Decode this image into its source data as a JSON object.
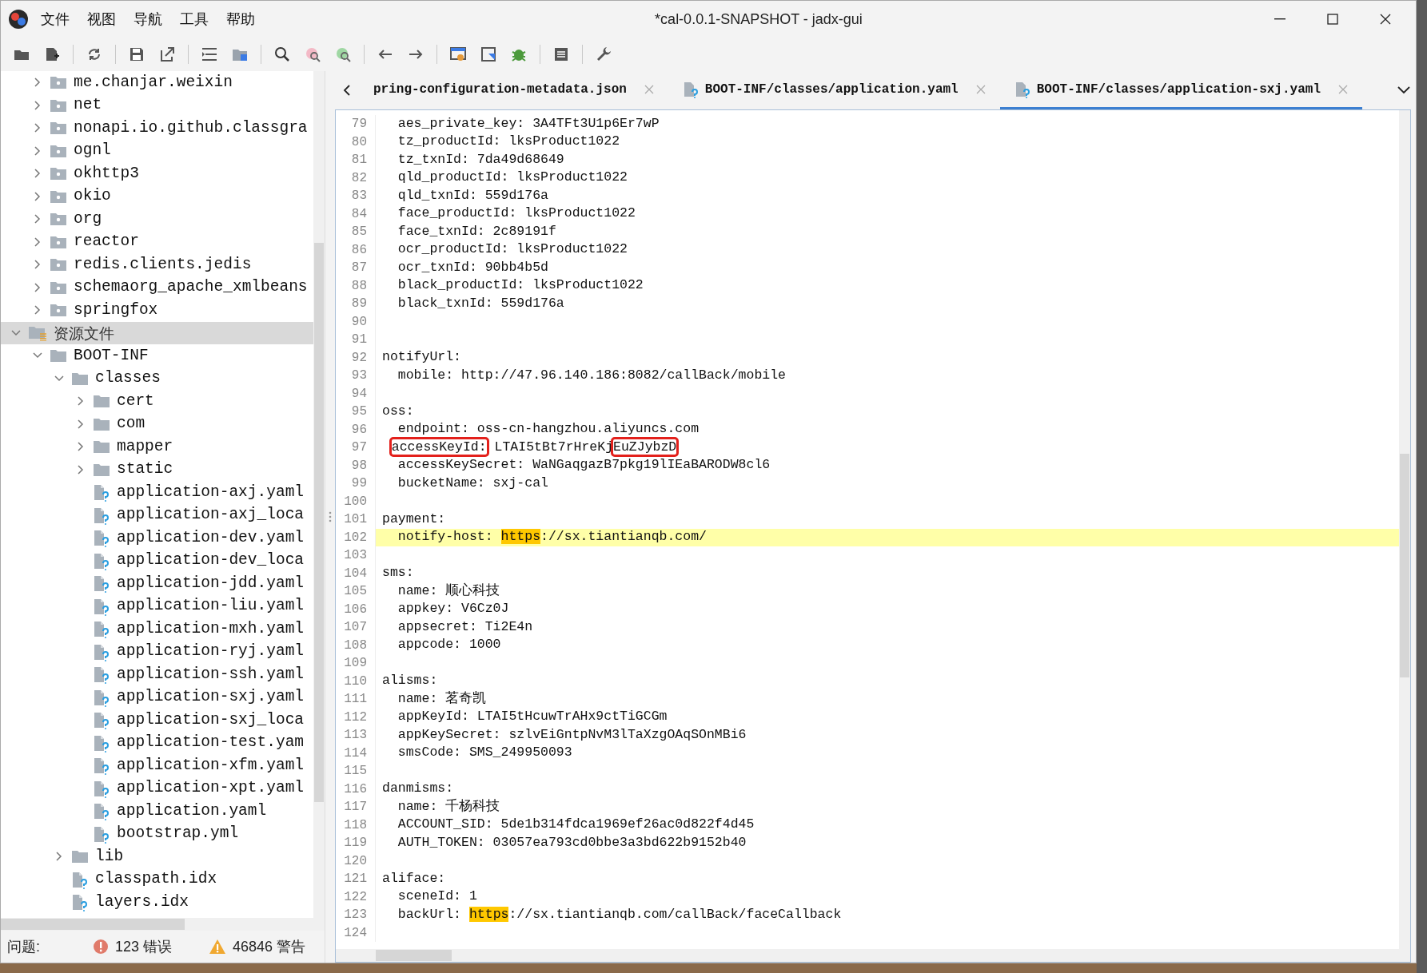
{
  "window": {
    "title": "*cal-0.0.1-SNAPSHOT - jadx-gui"
  },
  "menu": [
    "文件",
    "视图",
    "导航",
    "工具",
    "帮助"
  ],
  "tree": [
    {
      "children": [
        {
          "label": "me.chanjar.weixin",
          "kind": "package",
          "expanded": false,
          "selected": false
        },
        {
          "label": "net",
          "kind": "package",
          "expanded": false,
          "selected": false
        },
        {
          "label": "nonapi.io.github.classgra",
          "kind": "package",
          "expanded": false,
          "selected": false
        },
        {
          "label": "ognl",
          "kind": "package",
          "expanded": false,
          "selected": false
        },
        {
          "label": "okhttp3",
          "kind": "package",
          "expanded": false,
          "selected": false
        },
        {
          "label": "okio",
          "kind": "package",
          "expanded": false,
          "selected": false
        },
        {
          "label": "org",
          "kind": "package",
          "expanded": false,
          "selected": false
        },
        {
          "label": "reactor",
          "kind": "package",
          "expanded": false,
          "selected": false
        },
        {
          "label": "redis.clients.jedis",
          "kind": "package",
          "expanded": false,
          "selected": false
        },
        {
          "label": "schemaorg_apache_xmlbeans",
          "kind": "package",
          "expanded": false,
          "selected": false
        },
        {
          "label": "springfox",
          "kind": "package",
          "expanded": false,
          "selected": false
        }
      ]
    },
    {
      "label": "资源文件",
      "kind": "resources",
      "expanded": true,
      "selected": true,
      "children": [
        {
          "label": "BOOT-INF",
          "kind": "folder",
          "expanded": true,
          "selected": false,
          "children": [
            {
              "label": "classes",
              "kind": "folder",
              "expanded": true,
              "selected": false,
              "children": [
                {
                  "label": "cert",
                  "kind": "folder",
                  "expanded": false,
                  "selected": false
                },
                {
                  "label": "com",
                  "kind": "folder",
                  "expanded": false,
                  "selected": false
                },
                {
                  "label": "mapper",
                  "kind": "folder",
                  "expanded": false,
                  "selected": false
                },
                {
                  "label": "static",
                  "kind": "folder",
                  "expanded": false,
                  "selected": false
                },
                {
                  "label": "application-axj.yaml",
                  "kind": "file",
                  "selected": false
                },
                {
                  "label": "application-axj_loca",
                  "kind": "file",
                  "selected": false
                },
                {
                  "label": "application-dev.yaml",
                  "kind": "file",
                  "selected": false
                },
                {
                  "label": "application-dev_loca",
                  "kind": "file",
                  "selected": false
                },
                {
                  "label": "application-jdd.yaml",
                  "kind": "file",
                  "selected": false
                },
                {
                  "label": "application-liu.yaml",
                  "kind": "file",
                  "selected": false
                },
                {
                  "label": "application-mxh.yaml",
                  "kind": "file",
                  "selected": false
                },
                {
                  "label": "application-ryj.yaml",
                  "kind": "file",
                  "selected": false
                },
                {
                  "label": "application-ssh.yaml",
                  "kind": "file",
                  "selected": false
                },
                {
                  "label": "application-sxj.yaml",
                  "kind": "file",
                  "selected": false
                },
                {
                  "label": "application-sxj_loca",
                  "kind": "file",
                  "selected": false
                },
                {
                  "label": "application-test.yam",
                  "kind": "file",
                  "selected": false
                },
                {
                  "label": "application-xfm.yaml",
                  "kind": "file",
                  "selected": false
                },
                {
                  "label": "application-xpt.yaml",
                  "kind": "file",
                  "selected": false
                },
                {
                  "label": "application.yaml",
                  "kind": "file",
                  "selected": false
                },
                {
                  "label": "bootstrap.yml",
                  "kind": "file",
                  "selected": false
                }
              ]
            },
            {
              "label": "lib",
              "kind": "folder",
              "expanded": false,
              "selected": false
            },
            {
              "label": "classpath.idx",
              "kind": "file",
              "selected": false
            },
            {
              "label": "layers.idx",
              "kind": "file",
              "selected": false
            }
          ]
        }
      ]
    }
  ],
  "tabs": [
    {
      "label": "pring-configuration-metadata.json",
      "selected": false,
      "icon": false
    },
    {
      "label": "BOOT-INF/classes/application.yaml",
      "selected": false,
      "icon": true
    },
    {
      "label": "BOOT-INF/classes/application-sxj.yaml",
      "selected": true,
      "icon": true
    }
  ],
  "editor": {
    "lines": [
      {
        "no": "79",
        "text": "  aes_private_key: 3A4TFt3U1p6Er7wP",
        "current": false
      },
      {
        "no": "80",
        "text": "  tz_productId: lksProduct1022",
        "current": false
      },
      {
        "no": "81",
        "text": "  tz_txnId: 7da49d68649",
        "current": false
      },
      {
        "no": "82",
        "text": "  qld_productId: lksProduct1022",
        "current": false
      },
      {
        "no": "83",
        "text": "  qld_txnId: 559d176a",
        "current": false
      },
      {
        "no": "84",
        "text": "  face_productId: lksProduct1022",
        "current": false
      },
      {
        "no": "85",
        "text": "  face_txnId: 2c89191f",
        "current": false
      },
      {
        "no": "86",
        "text": "  ocr_productId: lksProduct1022",
        "current": false
      },
      {
        "no": "87",
        "text": "  ocr_txnId: 90bb4b5d",
        "current": false
      },
      {
        "no": "88",
        "text": "  black_productId: lksProduct1022",
        "current": false
      },
      {
        "no": "89",
        "text": "  black_txnId: 559d176a",
        "current": false
      },
      {
        "no": "90",
        "current": false
      },
      {
        "no": "91",
        "current": false
      },
      {
        "no": "92",
        "text": "notifyUrl:",
        "current": false
      },
      {
        "no": "93",
        "text": "  mobile: http://47.96.140.186:8082/callBack/mobile",
        "current": false
      },
      {
        "no": "94",
        "current": false
      },
      {
        "no": "95",
        "text": "oss:",
        "current": false
      },
      {
        "no": "96",
        "text": "  endpoint: oss-cn-hangzhou.aliyuncs.com",
        "current": false
      },
      {
        "no": "97",
        "current": false,
        "indented": true,
        "segments": [
          {
            "text": "accessKeyId:",
            "kind": "box"
          },
          {
            "text": " LTAI5tBt7rHreKj",
            "kind": "plain"
          },
          {
            "text": "EuZJybzD",
            "kind": "box"
          }
        ]
      },
      {
        "no": "98",
        "text": "  accessKeySecret: WaNGaqgazB7pkg19lIEaBARODW8cl6",
        "current": false
      },
      {
        "no": "99",
        "text": "  bucketName: sxj-cal",
        "current": false
      },
      {
        "no": "100",
        "current": false
      },
      {
        "no": "101",
        "text": "payment:",
        "current": false
      },
      {
        "no": "102",
        "current": true,
        "segments": [
          {
            "text": "  notify-host: ",
            "kind": "plain"
          },
          {
            "text": "https",
            "kind": "find"
          },
          {
            "text": "://sx.tiantianqb.com/",
            "kind": "plain"
          }
        ]
      },
      {
        "no": "103",
        "current": false
      },
      {
        "no": "104",
        "text": "sms:",
        "current": false
      },
      {
        "no": "105",
        "text": "  name: 顺心科技",
        "current": false
      },
      {
        "no": "106",
        "text": "  appkey: V6Cz0J",
        "current": false
      },
      {
        "no": "107",
        "text": "  appsecret: Ti2E4n",
        "current": false
      },
      {
        "no": "108",
        "text": "  appcode: 1000",
        "current": false
      },
      {
        "no": "109",
        "current": false
      },
      {
        "no": "110",
        "text": "alisms:",
        "current": false
      },
      {
        "no": "111",
        "text": "  name: 茗奇凯",
        "current": false
      },
      {
        "no": "112",
        "text": "  appKeyId: LTAI5tHcuwTrAHx9ctTiGCGm",
        "current": false
      },
      {
        "no": "113",
        "text": "  appKeySecret: szlvEiGntpNvM3lTaXzgOAqSOnMBi6",
        "current": false
      },
      {
        "no": "114",
        "text": "  smsCode: SMS_249950093",
        "current": false
      },
      {
        "no": "115",
        "current": false
      },
      {
        "no": "116",
        "text": "danmisms:",
        "current": false
      },
      {
        "no": "117",
        "text": "  name: 千杨科技",
        "current": false
      },
      {
        "no": "118",
        "text": "  ACCOUNT_SID: 5de1b314fdca1969ef26ac0d822f4d45",
        "current": false
      },
      {
        "no": "119",
        "text": "  AUTH_TOKEN: 03057ea793cd0bbe3a3bd622b9152b40",
        "current": false
      },
      {
        "no": "120",
        "current": false
      },
      {
        "no": "121",
        "text": "aliface:",
        "current": false
      },
      {
        "no": "122",
        "text": "  sceneId: 1",
        "current": false
      },
      {
        "no": "123",
        "current": false,
        "segments": [
          {
            "text": "  backUrl: ",
            "kind": "plain"
          },
          {
            "text": "https",
            "kind": "find"
          },
          {
            "text": "://sx.tiantianqb.com/callBack/faceCallback",
            "kind": "plain"
          }
        ]
      },
      {
        "no": "124",
        "current": false
      }
    ]
  },
  "status_bar": {
    "label": "问题:",
    "errors": "123 错误",
    "warnings": "46846 警告"
  }
}
